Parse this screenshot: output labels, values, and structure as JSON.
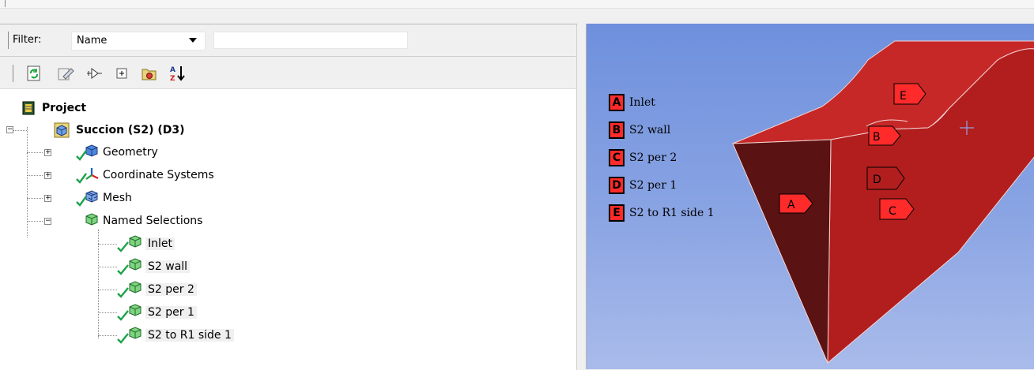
{
  "filter": {
    "label": "Filter:",
    "selected": "Name",
    "search_value": ""
  },
  "toolbar": {
    "buttons": [
      "refresh-icon",
      "edit-icon",
      "filter-icon",
      "expand-all-icon",
      "folder-icon",
      "sort-az-icon"
    ],
    "sort_glyph": "A Z"
  },
  "tree": {
    "project": "Project",
    "model": "Succion (S2) (D3)",
    "geometry": "Geometry",
    "coordinate_systems": "Coordinate Systems",
    "mesh": "Mesh",
    "named_selections": "Named Selections",
    "selections": [
      "Inlet",
      "S2 wall",
      "S2 per 2",
      "S2 per 1",
      "S2 to R1 side 1"
    ]
  },
  "viewport": {
    "legend": [
      {
        "key": "A",
        "label": "Inlet"
      },
      {
        "key": "B",
        "label": "S2 wall"
      },
      {
        "key": "C",
        "label": "S2 per 2"
      },
      {
        "key": "D",
        "label": "S2 per 1"
      },
      {
        "key": "E",
        "label": "S2 to R1 side 1"
      }
    ],
    "tags": [
      "A",
      "B",
      "C",
      "D",
      "E"
    ],
    "colors": {
      "legend_key": "#ff2a2a",
      "front_face": "#5e1212",
      "side_face": "#b52020",
      "top_face": "#c62828",
      "background_top": "#6e90dd",
      "background_bottom": "#a9bbea"
    }
  }
}
